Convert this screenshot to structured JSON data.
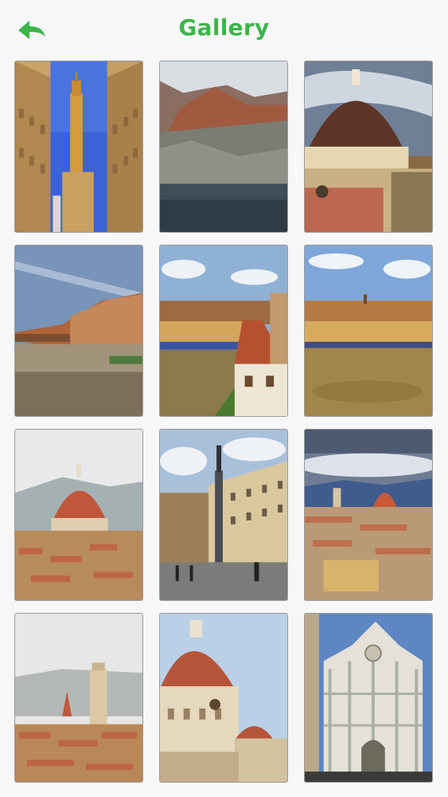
{
  "header": {
    "title": "Gallery",
    "back_icon": "back-arrow-icon",
    "accent_color": "#3cb54a"
  },
  "gallery": {
    "columns": 3,
    "rows": 4,
    "items": [
      {
        "subject": "uffizi-gallery-tower"
      },
      {
        "subject": "mountain-lake-landscape"
      },
      {
        "subject": "duomo-dome-aerial"
      },
      {
        "subject": "arno-river-buildings"
      },
      {
        "subject": "ponte-vecchio-rooftop"
      },
      {
        "subject": "ponte-vecchio-river"
      },
      {
        "subject": "duomo-city-skyline"
      },
      {
        "subject": "piazza-column-statue"
      },
      {
        "subject": "florence-cityscape-duomo"
      },
      {
        "subject": "florence-bell-tower-skyline"
      },
      {
        "subject": "duomo-dome-closeup"
      },
      {
        "subject": "cathedral-facade"
      }
    ]
  }
}
